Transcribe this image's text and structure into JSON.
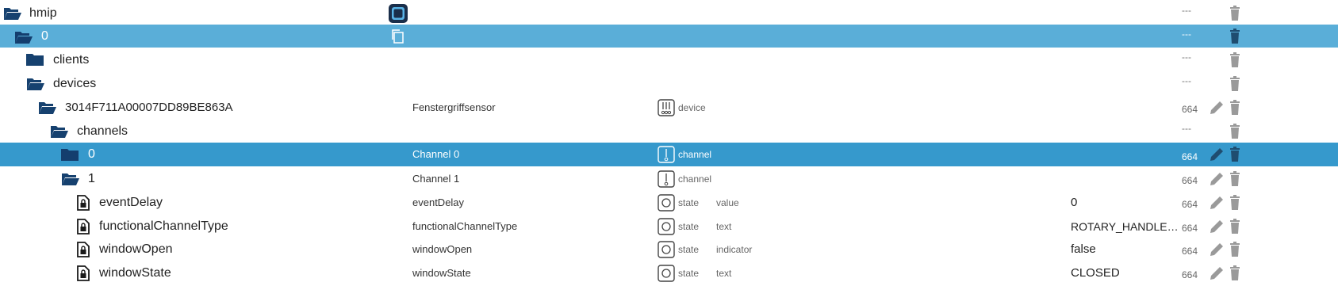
{
  "rows": [
    {
      "label": "hmip",
      "name": "",
      "type": "",
      "role": "",
      "value": "",
      "ack": "---"
    },
    {
      "label": "0",
      "name": "",
      "type": "",
      "role": "",
      "value": "",
      "ack": "---"
    },
    {
      "label": "clients",
      "name": "",
      "type": "",
      "role": "",
      "value": "",
      "ack": "---"
    },
    {
      "label": "devices",
      "name": "",
      "type": "",
      "role": "",
      "value": "",
      "ack": "---"
    },
    {
      "label": "3014F711A00007DD89BE863A",
      "name": "Fenstergriffsensor",
      "type": "device",
      "role": "",
      "value": "",
      "ack": "664"
    },
    {
      "label": "channels",
      "name": "",
      "type": "",
      "role": "",
      "value": "",
      "ack": "---"
    },
    {
      "label": "0",
      "name": "Channel 0",
      "type": "channel",
      "role": "",
      "value": "",
      "ack": "664"
    },
    {
      "label": "1",
      "name": "Channel 1",
      "type": "channel",
      "role": "",
      "value": "",
      "ack": "664"
    },
    {
      "label": "eventDelay",
      "name": "eventDelay",
      "type": "state",
      "role": "value",
      "value": "0",
      "ack": "664"
    },
    {
      "label": "functionalChannelType",
      "name": "functionalChannelType",
      "type": "state",
      "role": "text",
      "value": "ROTARY_HANDLE…",
      "ack": "664"
    },
    {
      "label": "windowOpen",
      "name": "windowOpen",
      "type": "state",
      "role": "indicator",
      "value": "false",
      "ack": "664"
    },
    {
      "label": "windowState",
      "name": "windowState",
      "type": "state",
      "role": "text",
      "value": "CLOSED",
      "ack": "664"
    }
  ],
  "icons": {
    "folder_open": "folder-open-icon",
    "folder_closed": "folder-icon",
    "state_file": "locked-file-icon",
    "device": "device-icon",
    "channel": "channel-icon",
    "state": "state-icon",
    "edit": "pencil-icon",
    "delete": "trash-icon",
    "copy": "copy-icon",
    "app": "app-logo-icon"
  },
  "colors": {
    "selected_light": "#5aaed8",
    "selected_dark": "#3699cc",
    "folder": "#16416f"
  }
}
